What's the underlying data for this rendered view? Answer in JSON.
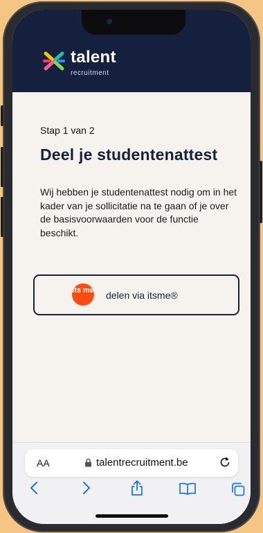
{
  "header": {
    "logo_word": "talent",
    "logo_sub": "recruitment"
  },
  "main": {
    "step": "Stap 1 van 2",
    "title": "Deel je studentenattest",
    "description": "Wij hebben je studentenattest nodig om in het kader van je sollicitatie na te gaan of je over de basisvoorwaarden voor de functie beschikt.",
    "share_button": {
      "itsme_logo": "its me",
      "label": "delen via itsme®"
    }
  },
  "browser": {
    "text_size_label": "AA",
    "url": "talentrecruitment.be",
    "icons": [
      "lock-icon",
      "reload-icon",
      "back-icon",
      "forward-icon",
      "share-icon",
      "bookmarks-icon",
      "tabs-icon"
    ]
  },
  "colors": {
    "brand_navy": "#15203f",
    "itsme_orange": "#ff4b12",
    "page_bg": "#f6f3ee",
    "ios_blue": "#1a73e8"
  }
}
